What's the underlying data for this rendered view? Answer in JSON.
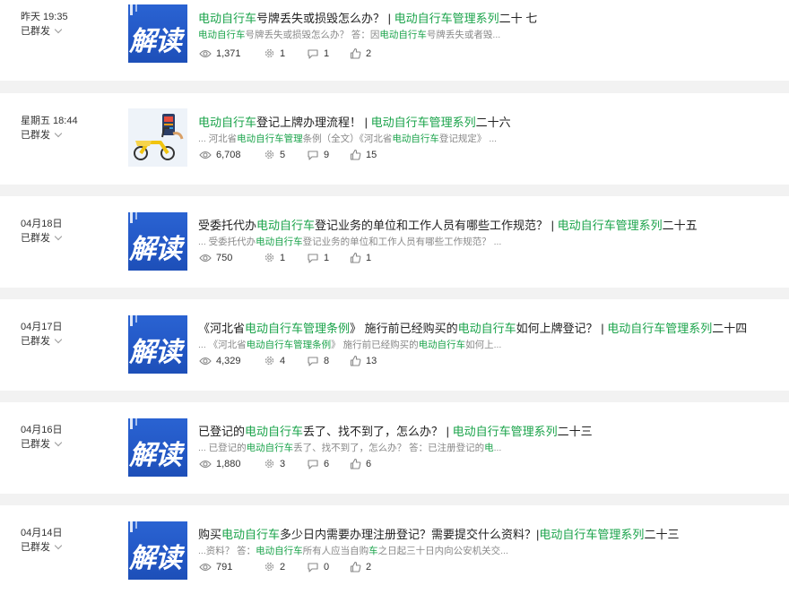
{
  "icons": [
    "eye-icon",
    "gear-icon",
    "comment-icon",
    "thumbs-up-icon"
  ],
  "colors": {
    "highlight": "#1aa34a",
    "thumb_blue": "#2358c6",
    "page_bg": "#f2f2f2"
  },
  "posts": [
    {
      "date": "昨天 19:35",
      "status": "已群发",
      "thumb_text": "解读",
      "title": {
        "p1": "",
        "hl1": "电动自行车",
        "p2": "号牌丢失或损毁怎么办？ | ",
        "hl2": "电动自行车管理系列",
        "p3": "二十 七"
      },
      "digest": {
        "p1": "",
        "hl1": "电动自行车",
        "p2": "号牌丢失或损毁怎么办？ 答：因",
        "hl2": "电动自行车",
        "p3": "号牌丢失或者毁..."
      },
      "reads": "1,371",
      "shares": "1",
      "comments": "1",
      "likes": "2"
    },
    {
      "date": "星期五 18:44",
      "status": "已群发",
      "thumb_text": "",
      "title": {
        "p1": "",
        "hl1": "电动自行车",
        "p2": "登记上牌办理流程！ | ",
        "hl2": "电动自行车管理系列",
        "p3": "二十六"
      },
      "digest": {
        "p1": "... 河北省",
        "hl1": "电动自行车管理",
        "p2": "条例（全文）《河北省",
        "hl2": "电动自行车",
        "p3": "登记规定》 ..."
      },
      "reads": "6,708",
      "shares": "5",
      "comments": "9",
      "likes": "15"
    },
    {
      "date": "04月18日",
      "status": "已群发",
      "thumb_text": "解读",
      "title": {
        "p1": "受委托代办",
        "hl1": "电动自行车",
        "p2": "登记业务的单位和工作人员有哪些工作规范？ | ",
        "hl2": "电动自行车管理系列",
        "p3": "二十五"
      },
      "digest": {
        "p1": "... 受委托代办",
        "hl1": "电动自行车",
        "p2": "登记业务的单位和工作人员有哪些工作规范？ ...",
        "hl2": "",
        "p3": ""
      },
      "reads": "750",
      "shares": "1",
      "comments": "1",
      "likes": "1"
    },
    {
      "date": "04月17日",
      "status": "已群发",
      "thumb_text": "解读",
      "title": {
        "p1": "《河北省",
        "hl1": "电动自行车管理条例",
        "p2": "》 施行前已经购买的",
        "hl2": "电动自行车",
        "p3": "如何上牌登记？ | ",
        "hl3": "电动自行车管理系列",
        "p4": "二十四"
      },
      "digest": {
        "p1": "... 《河北省",
        "hl1": "电动自行车管理条例",
        "p2": "》 施行前已经购买的",
        "hl2": "电动自行车",
        "p3": "如何上..."
      },
      "reads": "4,329",
      "shares": "4",
      "comments": "8",
      "likes": "13"
    },
    {
      "date": "04月16日",
      "status": "已群发",
      "thumb_text": "解读",
      "title": {
        "p1": "已登记的",
        "hl1": "电动自行车",
        "p2": "丢了、找不到了，怎么办？ | ",
        "hl2": "电动自行车管理系列",
        "p3": "二十三"
      },
      "digest": {
        "p1": "... 已登记的",
        "hl1": "电动自行车",
        "p2": "丢了、找不到了，怎么办？ 答：已注册登记的",
        "hl2": "电",
        "p3": "..."
      },
      "reads": "1,880",
      "shares": "3",
      "comments": "6",
      "likes": "6"
    },
    {
      "date": "04月14日",
      "status": "已群发",
      "thumb_text": "解读",
      "title": {
        "p1": "购买",
        "hl1": "电动自行车",
        "p2": "多少日内需要办理注册登记？需要提交什么资料？|",
        "hl2": "电动自行车管理系列",
        "p3": "二十三"
      },
      "digest": {
        "p1": "...资料？ 答：",
        "hl1": "电动自行车",
        "p2": "所有人应当自购",
        "hl2": "车",
        "p3": "之日起三十日内向公安机关交..."
      },
      "reads": "791",
      "shares": "2",
      "comments": "0",
      "likes": "2"
    }
  ]
}
